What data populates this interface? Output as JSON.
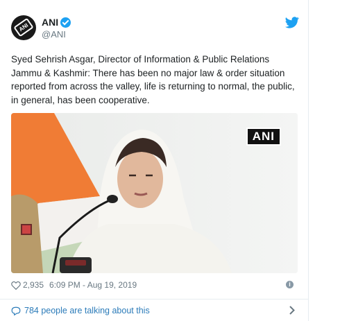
{
  "account": {
    "display_name": "ANI",
    "handle": "@ANI",
    "avatar_text": "ANI"
  },
  "tweet": {
    "text": "Syed Sehrish Asgar, Director of Information & Public Relations Jammu & Kashmir: There has been no major law & order situation reported from across the valley, life is returning to normal, the public, in general, has been cooperative.",
    "media_watermark": "ANI"
  },
  "meta": {
    "likes": "2,935",
    "timestamp": "6:09 PM - Aug 19, 2019"
  },
  "conversation": {
    "label": "784 people are talking about this"
  },
  "colors": {
    "link_blue": "#2b7bb9",
    "twitter_blue": "#1da1f2",
    "muted_text": "#697882"
  }
}
